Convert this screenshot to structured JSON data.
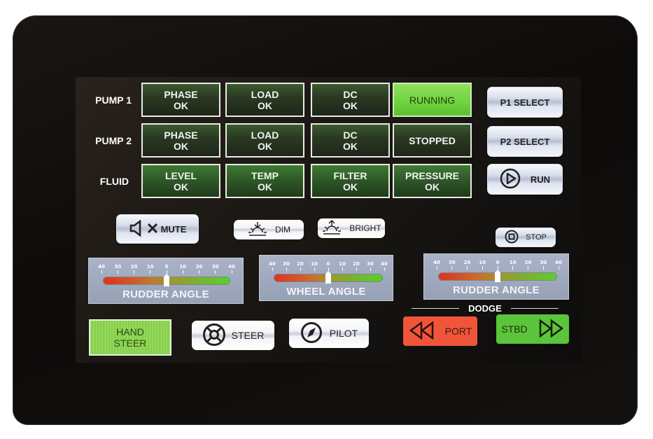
{
  "status_grid": {
    "rows": [
      {
        "label": "PUMP 1",
        "cells": [
          {
            "line1": "PHASE",
            "line2": "OK"
          },
          {
            "line1": "LOAD",
            "line2": "OK"
          },
          {
            "line1": "DC",
            "line2": "OK"
          },
          {
            "line1": "RUNNING",
            "line2": ""
          }
        ]
      },
      {
        "label": "PUMP 2",
        "cells": [
          {
            "line1": "PHASE",
            "line2": "OK"
          },
          {
            "line1": "LOAD",
            "line2": "OK"
          },
          {
            "line1": "DC",
            "line2": "OK"
          },
          {
            "line1": "STOPPED",
            "line2": ""
          }
        ]
      },
      {
        "label": "FLUID",
        "cells": [
          {
            "line1": "LEVEL",
            "line2": "OK"
          },
          {
            "line1": "TEMP",
            "line2": "OK"
          },
          {
            "line1": "FILTER",
            "line2": "OK"
          },
          {
            "line1": "PRESSURE",
            "line2": "OK"
          }
        ]
      }
    ]
  },
  "pump_controls": {
    "p1_select": "P1 SELECT",
    "p2_select": "P2 SELECT",
    "run": "RUN",
    "stop": "STOP"
  },
  "display_controls": {
    "mute": "MUTE",
    "dim": "DIM",
    "bright": "BRIGHT"
  },
  "gauges": {
    "tick_labels": [
      "40",
      "30",
      "20",
      "10",
      "0",
      "10",
      "20",
      "30",
      "40"
    ],
    "left": {
      "title": "RUDDER ANGLE",
      "value": 0,
      "range": [
        -40,
        40
      ]
    },
    "center": {
      "title": "WHEEL ANGLE",
      "value": 0,
      "range": [
        -40,
        40
      ]
    },
    "right": {
      "title": "RUDDER ANGLE",
      "value": 0,
      "range": [
        -40,
        40
      ]
    }
  },
  "steering": {
    "hand_steer_line1": "HAND",
    "hand_steer_line2": "STEER",
    "steer": "STEER",
    "pilot": "PILOT"
  },
  "dodge": {
    "title": "DODGE",
    "port": "PORT",
    "stbd": "STBD",
    "port_color": "#f0553a",
    "stbd_color": "#5cc43a"
  }
}
